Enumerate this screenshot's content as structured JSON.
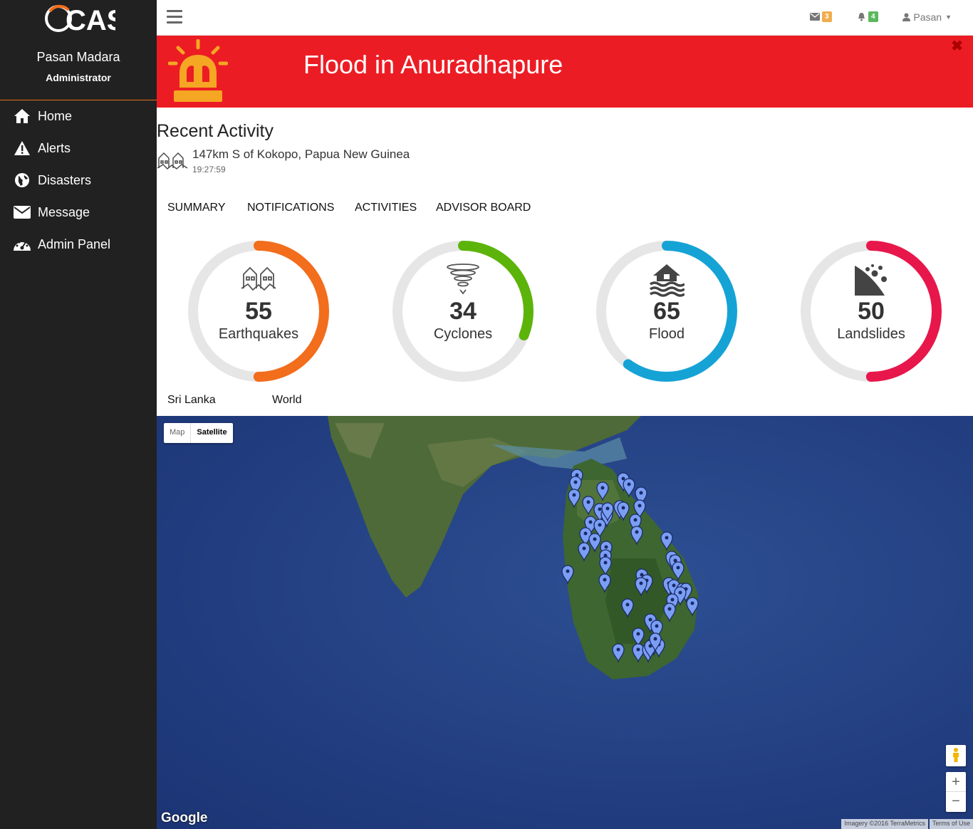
{
  "app": {
    "logo_text": "CAS"
  },
  "sidebar": {
    "user_name": "Pasan Madara",
    "user_role": "Administrator",
    "items": [
      {
        "label": "Home",
        "icon": "home-icon"
      },
      {
        "label": "Alerts",
        "icon": "warning-icon"
      },
      {
        "label": "Disasters",
        "icon": "globe-icon"
      },
      {
        "label": "Message",
        "icon": "envelope-icon"
      },
      {
        "label": "Admin Panel",
        "icon": "dashboard-icon"
      }
    ]
  },
  "topbar": {
    "messages_count": "3",
    "notifications_count": "4",
    "user": "Pasan"
  },
  "alert": {
    "title": "Flood in Anuradhapure"
  },
  "recent": {
    "title": "Recent Activity",
    "item_text": "147km S of Kokopo, Papua New Guinea",
    "item_time": "19:27:59"
  },
  "tabs": [
    "SUMMARY",
    "NOTIFICATIONS",
    "ACTIVITIES",
    "ADVISOR BOARD"
  ],
  "gauges": [
    {
      "value": "55",
      "label": "Earthquakes",
      "fraction": 0.5,
      "color": "#f26d1c",
      "icon": "earthquake-icon"
    },
    {
      "value": "34",
      "label": "Cyclones",
      "fraction": 0.31,
      "color": "#5cb40a",
      "icon": "cyclone-icon"
    },
    {
      "value": "65",
      "label": "Flood",
      "fraction": 0.6,
      "color": "#15a3d6",
      "icon": "flood-icon"
    },
    {
      "value": "50",
      "label": "Landslides",
      "fraction": 0.5,
      "color": "#e8174b",
      "icon": "landslide-icon"
    }
  ],
  "scopes": [
    "Sri Lanka",
    "World"
  ],
  "map": {
    "type_map": "Map",
    "type_satellite": "Satellite",
    "attribution": "Imagery ©2016 TerraMetrics",
    "terms": "Terms of Use",
    "brand": "Google"
  }
}
